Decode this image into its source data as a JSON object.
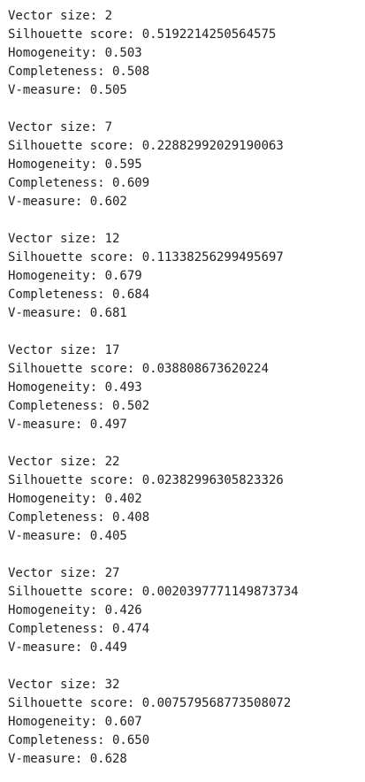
{
  "output": {
    "blocks": [
      {
        "vector_size": "Vector size: 2",
        "silhouette": "Silhouette score: 0.5192214250564575",
        "homogeneity": "Homogeneity: 0.503",
        "completeness": "Completeness: 0.508",
        "v_measure": "V-measure: 0.505"
      },
      {
        "vector_size": "Vector size: 7",
        "silhouette": "Silhouette score: 0.22882992029190063",
        "homogeneity": "Homogeneity: 0.595",
        "completeness": "Completeness: 0.609",
        "v_measure": "V-measure: 0.602"
      },
      {
        "vector_size": "Vector size: 12",
        "silhouette": "Silhouette score: 0.11338256299495697",
        "homogeneity": "Homogeneity: 0.679",
        "completeness": "Completeness: 0.684",
        "v_measure": "V-measure: 0.681"
      },
      {
        "vector_size": "Vector size: 17",
        "silhouette": "Silhouette score: 0.038808673620224",
        "homogeneity": "Homogeneity: 0.493",
        "completeness": "Completeness: 0.502",
        "v_measure": "V-measure: 0.497"
      },
      {
        "vector_size": "Vector size: 22",
        "silhouette": "Silhouette score: 0.02382996305823326",
        "homogeneity": "Homogeneity: 0.402",
        "completeness": "Completeness: 0.408",
        "v_measure": "V-measure: 0.405"
      },
      {
        "vector_size": "Vector size: 27",
        "silhouette": "Silhouette score: 0.0020397771149873734",
        "homogeneity": "Homogeneity: 0.426",
        "completeness": "Completeness: 0.474",
        "v_measure": "V-measure: 0.449"
      },
      {
        "vector_size": "Vector size: 32",
        "silhouette": "Silhouette score: 0.007579568773508072",
        "homogeneity": "Homogeneity: 0.607",
        "completeness": "Completeness: 0.650",
        "v_measure": "V-measure: 0.628"
      }
    ]
  }
}
